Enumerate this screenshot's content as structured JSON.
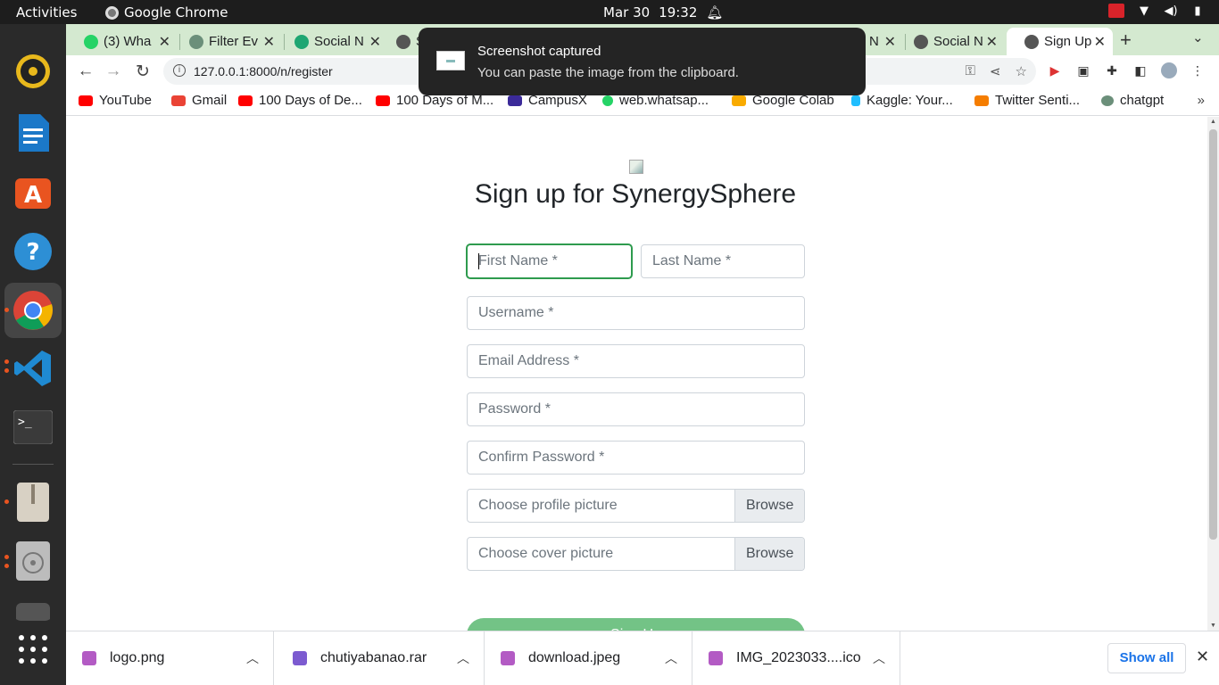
{
  "topbar": {
    "activities": "Activities",
    "app_name": "Google Chrome",
    "date": "Mar 30",
    "time": "19:32"
  },
  "tabs": [
    {
      "label": "(3) Wha",
      "favicon": "whatsapp-icon",
      "color": "#25d366"
    },
    {
      "label": "Filter Ev",
      "favicon": "openai-icon",
      "color": "#6b8f7a"
    },
    {
      "label": "Social N",
      "favicon": "diagram-icon",
      "color": "#1ea672"
    },
    {
      "label": "S",
      "favicon": "globe-icon",
      "color": "#555"
    },
    {
      "label": "N",
      "favicon": "globe-icon",
      "color": "#555"
    },
    {
      "label": "Social N",
      "favicon": "globe-icon",
      "color": "#555"
    },
    {
      "label": "Sign Up",
      "favicon": "globe-icon",
      "color": "#555",
      "active": true
    }
  ],
  "toolbar": {
    "url": "127.0.0.1:8000/n/register"
  },
  "bookmarks": [
    {
      "label": "YouTube",
      "color": "#ff0000"
    },
    {
      "label": "Gmail",
      "color": "#ea4335"
    },
    {
      "label": "100 Days of De...",
      "color": "#ff0000"
    },
    {
      "label": "100 Days of M...",
      "color": "#ff0000"
    },
    {
      "label": "CampusX",
      "color": "#3b2a99"
    },
    {
      "label": "web.whatsap...",
      "color": "#25d366"
    },
    {
      "label": "Google Colab",
      "color": "#f9ab00"
    },
    {
      "label": "Kaggle: Your...",
      "color": "#20beff"
    },
    {
      "label": "Twitter Senti...",
      "color": "#f57d00"
    },
    {
      "label": "chatgpt",
      "color": "#6b8f7a"
    }
  ],
  "notification": {
    "title": "Screenshot captured",
    "body": "You can paste the image from the clipboard."
  },
  "form": {
    "title": "Sign up for SynergySphere",
    "first_name": "First Name *",
    "last_name": "Last Name *",
    "username": "Username *",
    "email": "Email Address *",
    "password": "Password *",
    "confirm_password": "Confirm Password *",
    "profile_picture": "Choose profile picture",
    "cover_picture": "Choose cover picture",
    "browse": "Browse",
    "submit": "Sign Up"
  },
  "downloads": [
    {
      "name": "logo.png",
      "type": "image"
    },
    {
      "name": "chutiyabanao.rar",
      "type": "archive"
    },
    {
      "name": "download.jpeg",
      "type": "image"
    },
    {
      "name": "IMG_2023033....ico",
      "type": "image"
    }
  ],
  "shelf": {
    "show_all": "Show all"
  }
}
